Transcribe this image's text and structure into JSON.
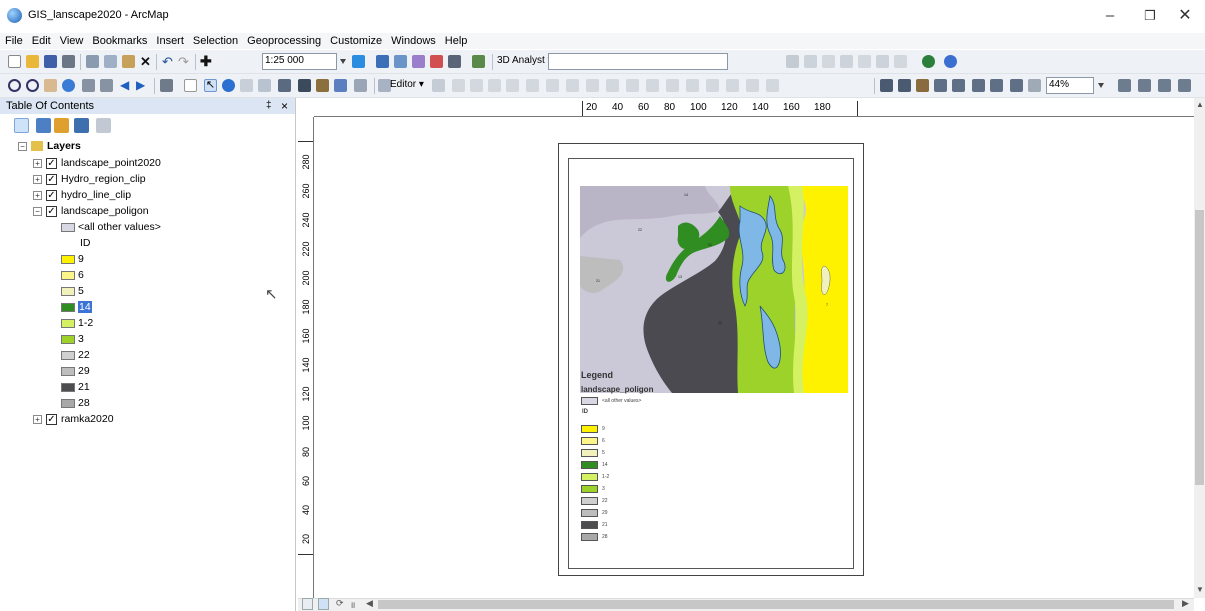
{
  "window": {
    "title": "GIS_lanscape2020 - ArcMap",
    "minimize": "–",
    "maximize": "❐",
    "close": "✕"
  },
  "menu": [
    "File",
    "Edit",
    "View",
    "Bookmarks",
    "Insert",
    "Selection",
    "Geoprocessing",
    "Customize",
    "Windows",
    "Help"
  ],
  "toolbar1": {
    "scale": "1:25 000",
    "analyst_label": "3D Analyst ▾",
    "analyst_value": ""
  },
  "toolbar2": {
    "editor_label": "Editor ▾",
    "zoom": "44%"
  },
  "toc": {
    "title": "Table Of Contents",
    "pin": "‡",
    "close": "×",
    "root": "Layers",
    "layers": [
      {
        "name": "landscape_point2020",
        "checked": true
      },
      {
        "name": "Hydro_region_clip",
        "checked": true
      },
      {
        "name": "hydro_line_clip",
        "checked": true
      },
      {
        "name": "landscape_poligon",
        "checked": true
      },
      {
        "name": "ramka2020",
        "checked": true
      }
    ],
    "other_values": "<all other values>",
    "field": "ID",
    "classes": [
      {
        "label": "9",
        "color": "#fff200"
      },
      {
        "label": "6",
        "color": "#fbf58a"
      },
      {
        "label": "5",
        "color": "#f1f1bd"
      },
      {
        "label": "14",
        "color": "#2f8d22"
      },
      {
        "label": "1-2",
        "color": "#d4f063"
      },
      {
        "label": "3",
        "color": "#9cd22a"
      },
      {
        "label": "22",
        "color": "#cfcfcf"
      },
      {
        "label": "29",
        "color": "#bdbdbd"
      },
      {
        "label": "21",
        "color": "#4d4d50"
      },
      {
        "label": "28",
        "color": "#a8a8a8"
      }
    ]
  },
  "hruler_labels": [
    "20",
    "40",
    "60",
    "80",
    "100",
    "120",
    "140",
    "160",
    "180"
  ],
  "vruler_labels": [
    "280",
    "260",
    "240",
    "220",
    "200",
    "180",
    "160",
    "140",
    "120",
    "100",
    "80",
    "60",
    "40",
    "20"
  ],
  "page_legend": {
    "title": "Legend",
    "layer": "landscape_poligon",
    "other_values": "<all other values>",
    "field": "ID",
    "classes": [
      "9",
      "6",
      "5",
      "14",
      "1-2",
      "3",
      "22",
      "29",
      "21",
      "28"
    ]
  },
  "colors": {
    "water": "#7fb8e6",
    "lavender": "#cbc8d8",
    "dark_gray": "#4a4a50",
    "dark_green": "#2f8d22"
  }
}
